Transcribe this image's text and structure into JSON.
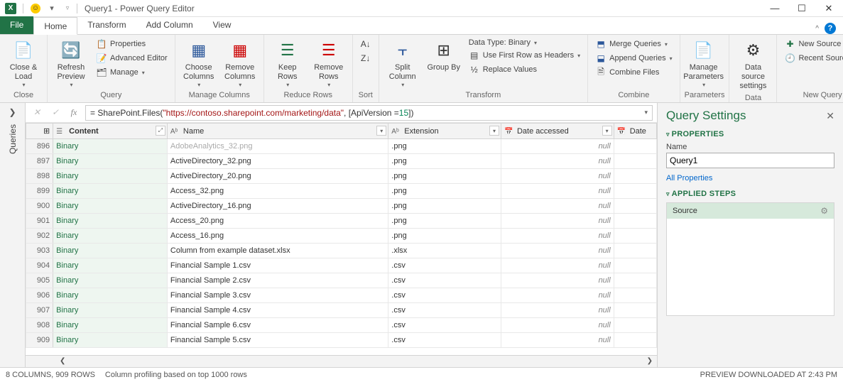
{
  "window": {
    "title": "Query1 - Power Query Editor"
  },
  "tabs": {
    "file": "File",
    "home": "Home",
    "transform": "Transform",
    "add_column": "Add Column",
    "view": "View"
  },
  "ribbon": {
    "close": {
      "close_load": "Close &\nLoad",
      "group": "Close"
    },
    "query": {
      "refresh": "Refresh\nPreview",
      "properties": "Properties",
      "advanced": "Advanced Editor",
      "manage": "Manage",
      "group": "Query"
    },
    "manage_cols": {
      "choose": "Choose\nColumns",
      "remove": "Remove\nColumns",
      "group": "Manage Columns"
    },
    "reduce": {
      "keep": "Keep\nRows",
      "remove": "Remove\nRows",
      "group": "Reduce Rows"
    },
    "sort": {
      "group": "Sort"
    },
    "transform": {
      "split": "Split\nColumn",
      "groupby": "Group\nBy",
      "datatype": "Data Type: Binary",
      "firstrow": "Use First Row as Headers",
      "replace": "Replace Values",
      "group": "Transform"
    },
    "combine": {
      "merge": "Merge Queries",
      "append": "Append Queries",
      "files": "Combine Files",
      "group": "Combine"
    },
    "params": {
      "manage": "Manage\nParameters",
      "group": "Parameters"
    },
    "datasrc": {
      "settings": "Data source\nsettings",
      "group": "Data Sources"
    },
    "newq": {
      "new": "New Source",
      "recent": "Recent Sources",
      "group": "New Query"
    }
  },
  "left_rail": "Queries",
  "formula": {
    "prefix": "= SharePoint.Files(",
    "url": "\"https://contoso.sharepoint.com/marketing/data\"",
    "mid": ", [ApiVersion = ",
    "num": "15",
    "suffix": "])"
  },
  "columns": [
    "Content",
    "Name",
    "Extension",
    "Date accessed",
    "Date"
  ],
  "rows": [
    {
      "n": 896,
      "content": "Binary",
      "name": "AdobeAnalytics_32.png",
      "ext": ".png",
      "date": "null"
    },
    {
      "n": 897,
      "content": "Binary",
      "name": "ActiveDirectory_32.png",
      "ext": ".png",
      "date": "null"
    },
    {
      "n": 898,
      "content": "Binary",
      "name": "ActiveDirectory_20.png",
      "ext": ".png",
      "date": "null"
    },
    {
      "n": 899,
      "content": "Binary",
      "name": "Access_32.png",
      "ext": ".png",
      "date": "null"
    },
    {
      "n": 900,
      "content": "Binary",
      "name": "ActiveDirectory_16.png",
      "ext": ".png",
      "date": "null"
    },
    {
      "n": 901,
      "content": "Binary",
      "name": "Access_20.png",
      "ext": ".png",
      "date": "null"
    },
    {
      "n": 902,
      "content": "Binary",
      "name": "Access_16.png",
      "ext": ".png",
      "date": "null"
    },
    {
      "n": 903,
      "content": "Binary",
      "name": "Column from example dataset.xlsx",
      "ext": ".xlsx",
      "date": "null"
    },
    {
      "n": 904,
      "content": "Binary",
      "name": "Financial Sample 1.csv",
      "ext": ".csv",
      "date": "null"
    },
    {
      "n": 905,
      "content": "Binary",
      "name": "Financial Sample 2.csv",
      "ext": ".csv",
      "date": "null"
    },
    {
      "n": 906,
      "content": "Binary",
      "name": "Financial Sample 3.csv",
      "ext": ".csv",
      "date": "null"
    },
    {
      "n": 907,
      "content": "Binary",
      "name": "Financial Sample 4.csv",
      "ext": ".csv",
      "date": "null"
    },
    {
      "n": 908,
      "content": "Binary",
      "name": "Financial Sample 6.csv",
      "ext": ".csv",
      "date": "null"
    },
    {
      "n": 909,
      "content": "Binary",
      "name": "Financial Sample 5.csv",
      "ext": ".csv",
      "date": "null"
    }
  ],
  "settings": {
    "title": "Query Settings",
    "properties": "PROPERTIES",
    "name_lbl": "Name",
    "name_val": "Query1",
    "all_props": "All Properties",
    "applied": "APPLIED STEPS",
    "step1": "Source"
  },
  "status": {
    "left1": "8 COLUMNS, 909 ROWS",
    "left2": "Column profiling based on top 1000 rows",
    "right": "PREVIEW DOWNLOADED AT 2:43 PM"
  }
}
